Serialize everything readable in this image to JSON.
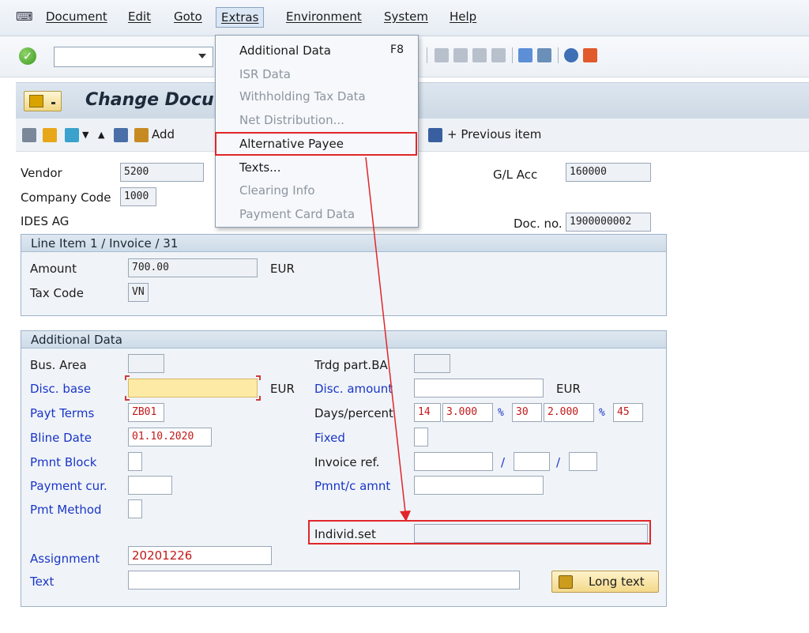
{
  "menubar": {
    "items": [
      {
        "label": "Document"
      },
      {
        "label": "Edit"
      },
      {
        "label": "Goto"
      },
      {
        "label": "Extras"
      },
      {
        "label": "Environment"
      },
      {
        "label": "System"
      },
      {
        "label": "Help"
      }
    ]
  },
  "extras_menu": {
    "items": [
      {
        "label": "Additional Data",
        "shortcut": "F8",
        "enabled": true
      },
      {
        "label": "ISR Data",
        "enabled": false
      },
      {
        "label": "Withholding Tax Data",
        "enabled": false
      },
      {
        "label": "Net Distribution...",
        "enabled": false
      },
      {
        "label": "Alternative Payee",
        "enabled": true,
        "highlighted": true
      },
      {
        "label": "Texts...",
        "enabled": true
      },
      {
        "label": "Clearing Info",
        "enabled": false
      },
      {
        "label": "Payment Card Data",
        "enabled": false
      }
    ]
  },
  "title": {
    "text": "Change Docu"
  },
  "app_toolbar": {
    "add_label": "Add",
    "previous_item_label": "+ Previous item"
  },
  "header": {
    "vendor_label": "Vendor",
    "vendor_value": "5200",
    "company_code_label": "Company Code",
    "company_code_value": "1000",
    "company_name": "IDES AG",
    "gl_acc_label": "G/L Acc",
    "gl_acc_value": "160000",
    "doc_no_label": "Doc. no.",
    "doc_no_value": "1900000002"
  },
  "line_item": {
    "heading": "Line Item 1 / Invoice / 31",
    "amount_label": "Amount",
    "amount_value": "700.00",
    "amount_currency": "EUR",
    "tax_code_label": "Tax Code",
    "tax_code_value": "VN"
  },
  "additional_data": {
    "heading": "Additional Data",
    "bus_area_label": "Bus. Area",
    "bus_area_value": "",
    "trdg_part_label": "Trdg part.BA",
    "trdg_part_value": "",
    "disc_base_label": "Disc. base",
    "disc_base_value": "",
    "disc_base_currency": "EUR",
    "disc_amount_label": "Disc. amount",
    "disc_amount_value": "",
    "disc_amount_currency": "EUR",
    "payt_terms_label": "Payt Terms",
    "payt_terms_value": "ZB01",
    "days_percent_label": "Days/percent",
    "days1": "14",
    "pct1": "3.000",
    "days2": "30",
    "pct2": "2.000",
    "days3": "45",
    "pct_sign": "%",
    "bline_date_label": "Bline Date",
    "bline_date_value": "01.10.2020",
    "fixed_label": "Fixed",
    "pmnt_block_label": "Pmnt Block",
    "invoice_ref_label": "Invoice ref.",
    "slash": "/",
    "payment_cur_label": "Payment cur.",
    "pmnt_c_amnt_label": "Pmnt/c amnt",
    "pmt_method_label": "Pmt Method",
    "individ_set_label": "Individ.set",
    "individ_set_value": "",
    "assignment_label": "Assignment",
    "assignment_value": "20201226",
    "text_label": "Text",
    "text_value": "",
    "long_text_label": "Long text"
  }
}
